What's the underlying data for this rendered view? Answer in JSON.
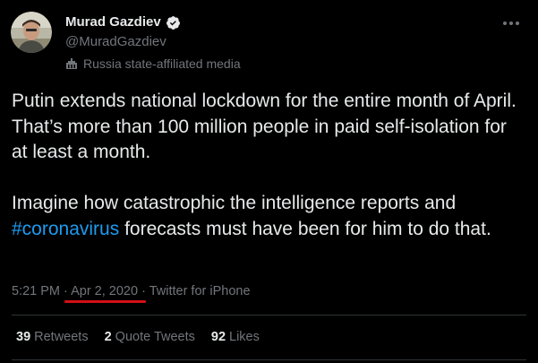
{
  "author": {
    "display_name": "Murad Gazdiev",
    "handle": "@MuradGazdiev",
    "affiliation_label": "Russia state-affiliated media",
    "avatar_icon": "avatar-photo",
    "verified_icon": "verified-badge-icon"
  },
  "tweet": {
    "para1": "Putin extends national lockdown for the entire month of April. That’s more than 100 million people in paid self-isolation for at least a month.",
    "para2_before": "Imagine how catastrophic the intelligence reports and ",
    "hashtag": "#coronavirus",
    "para2_after": " forecasts must have been for him to do that."
  },
  "meta": {
    "time": "5:21 PM",
    "sep1": " · ",
    "date": "Apr 2, 2020",
    "sep2": " · ",
    "source": "Twitter for iPhone"
  },
  "stats": [
    {
      "count": "39",
      "label": "Retweets"
    },
    {
      "count": "2",
      "label": "Quote Tweets"
    },
    {
      "count": "92",
      "label": "Likes"
    }
  ],
  "colors": {
    "background": "#000000",
    "text": "#e7e9ea",
    "muted": "#71767b",
    "accent": "#1d9bf0",
    "verified": "#1d9bf0",
    "annotation_underline": "#d10f16"
  }
}
